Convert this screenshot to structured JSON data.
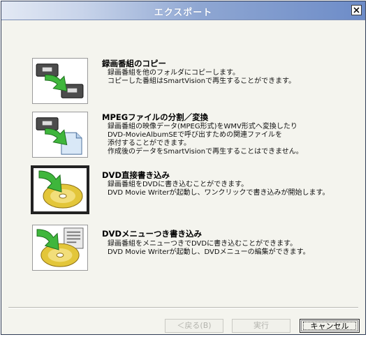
{
  "window": {
    "title": "エクスポート",
    "close_icon": "close-icon"
  },
  "options": [
    {
      "icon": "tape-copy-icon",
      "title": "録画番組のコピー",
      "desc": [
        "録画番組を他のフォルダにコピーします。",
        "コピーした番組はSmartVisionで再生することができます。"
      ]
    },
    {
      "icon": "mpeg-split-convert-icon",
      "title": "MPEGファイルの分割／変換",
      "desc": [
        "録画番組の映像データ(MPEG形式)をWMV形式へ変換したり",
        "DVD-MovieAlbumSEで呼び出すための関連ファイルを",
        "添付することができます。",
        "作成後のデータをSmartVisionで再生することはできません。"
      ]
    },
    {
      "icon": "dvd-write-icon",
      "title": "DVD直接書き込み",
      "desc": [
        "録画番組をDVDに書き込むことができます。",
        "DVD Movie Writerが起動し、ワンクリックで書き込みが開始します。"
      ],
      "selected": true
    },
    {
      "icon": "dvd-menu-write-icon",
      "title": "DVDメニューつき書き込み",
      "desc": [
        "録画番組をメニューつきでDVDに書き込むことができます。",
        "DVD Movie Writerが起動し、DVDメニューの編集ができます。"
      ]
    }
  ],
  "buttons": {
    "back": "＜戻る(B)",
    "run": "実行",
    "cancel": "キャンセル"
  },
  "colors": {
    "title_gradient_start": "#e3e9f4",
    "title_gradient_end": "#6d8cc8",
    "arrow_green": "#34b03a",
    "disc_gold": "#e0c23a"
  }
}
